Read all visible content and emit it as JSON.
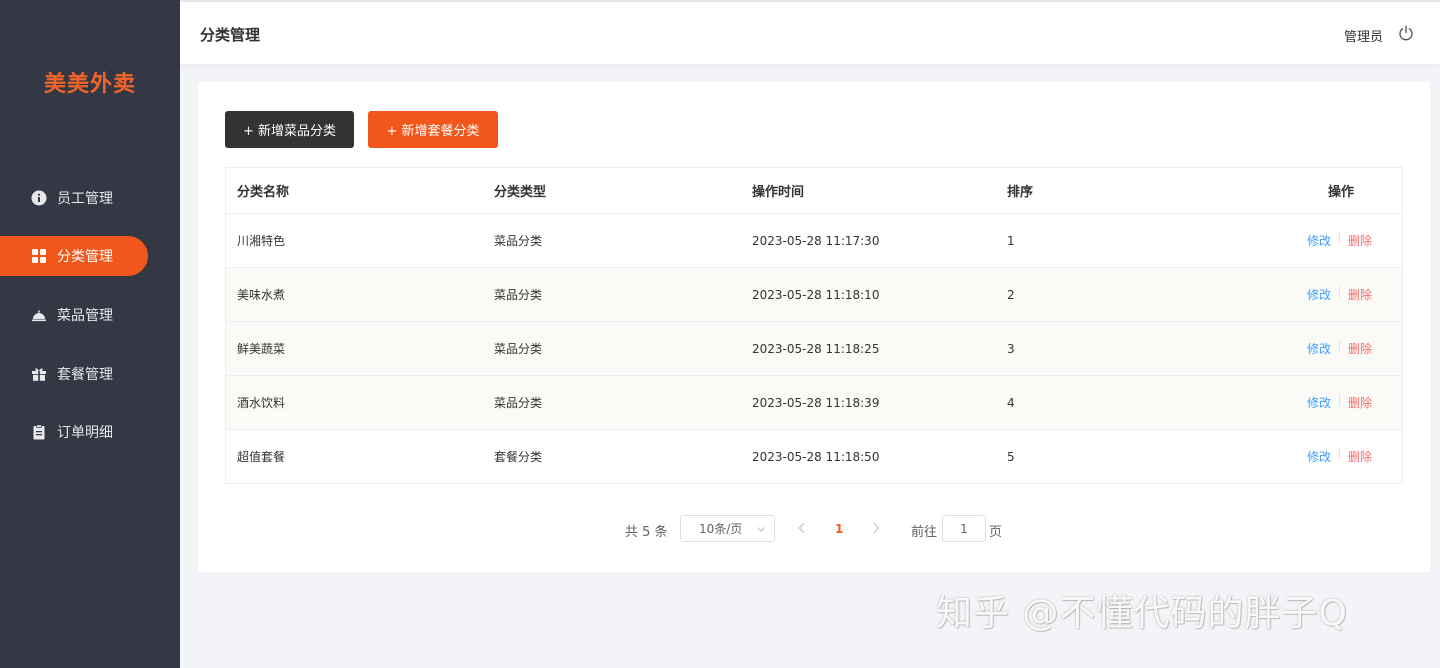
{
  "brand": {
    "name": "美美外卖",
    "color": "#f1571a"
  },
  "sidebar": {
    "items": [
      {
        "label": "员工管理",
        "icon": "info-circle-icon",
        "active": false
      },
      {
        "label": "分类管理",
        "icon": "grid-icon",
        "active": true
      },
      {
        "label": "菜品管理",
        "icon": "cloche-icon",
        "active": false
      },
      {
        "label": "套餐管理",
        "icon": "gift-icon",
        "active": false
      },
      {
        "label": "订单明细",
        "icon": "clipboard-icon",
        "active": false
      }
    ]
  },
  "header": {
    "title": "分类管理",
    "user": "管理员",
    "logout_icon": "power-icon"
  },
  "toolbar": {
    "add_dish_category": "+ 新增菜品分类",
    "add_combo_category": "+ 新增套餐分类"
  },
  "table": {
    "columns": [
      "分类名称",
      "分类类型",
      "操作时间",
      "排序",
      "操作"
    ],
    "rows": [
      {
        "name": "川湘特色",
        "type": "菜品分类",
        "time": "2023-05-28 11:17:30",
        "sort": "1"
      },
      {
        "name": "美味水煮",
        "type": "菜品分类",
        "time": "2023-05-28 11:18:10",
        "sort": "2"
      },
      {
        "name": "鲜美蔬菜",
        "type": "菜品分类",
        "time": "2023-05-28 11:18:25",
        "sort": "3"
      },
      {
        "name": "酒水饮料",
        "type": "菜品分类",
        "time": "2023-05-28 11:18:39",
        "sort": "4"
      },
      {
        "name": "超值套餐",
        "type": "套餐分类",
        "time": "2023-05-28 11:18:50",
        "sort": "5"
      }
    ],
    "actions": {
      "edit": "修改",
      "delete": "删除"
    }
  },
  "pagination": {
    "total": "共 5 条",
    "page_size": "10条/页",
    "current_page": "1",
    "goto_label": "前往",
    "goto_value": "1",
    "page_suffix": "页"
  },
  "watermark": "知乎 @不懂代码的胖子Q"
}
